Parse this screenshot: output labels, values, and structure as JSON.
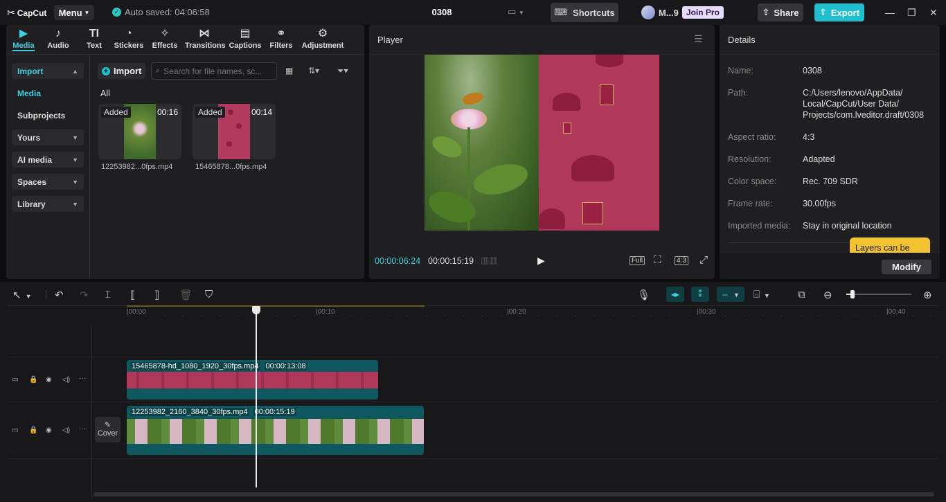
{
  "app": {
    "logo": "CapCut",
    "menu": "Menu",
    "autosave": "Auto saved: 04:06:58",
    "project": "0308",
    "shortcuts": "Shortcuts",
    "user": "M...9",
    "join_pro": "Join Pro",
    "share": "Share",
    "export": "Export"
  },
  "toolbar": [
    {
      "label": "Media",
      "icon": "media-icon",
      "active": true
    },
    {
      "label": "Audio",
      "icon": "audio-icon"
    },
    {
      "label": "Text",
      "icon": "text-icon"
    },
    {
      "label": "Stickers",
      "icon": "stickers-icon"
    },
    {
      "label": "Effects",
      "icon": "effects-icon"
    },
    {
      "label": "Transitions",
      "icon": "transitions-icon"
    },
    {
      "label": "Captions",
      "icon": "captions-icon"
    },
    {
      "label": "Filters",
      "icon": "filters-icon"
    },
    {
      "label": "Adjustment",
      "icon": "adjustment-icon"
    }
  ],
  "sidebar": {
    "import": "Import",
    "media": "Media",
    "subprojects": "Subprojects",
    "yours": "Yours",
    "ai_media": "AI media",
    "spaces": "Spaces",
    "library": "Library"
  },
  "media": {
    "import_btn": "Import",
    "search_placeholder": "Search for file names, sc...",
    "filter_all": "All",
    "items": [
      {
        "badge": "Added",
        "duration": "00:16",
        "name": "12253982...0fps.mp4"
      },
      {
        "badge": "Added",
        "duration": "00:14",
        "name": "15465878...0fps.mp4"
      }
    ]
  },
  "player": {
    "title": "Player",
    "current_time": "00:00:06:24",
    "total_time": "00:00:15:19",
    "full": "Full",
    "ratio": "4:3"
  },
  "details": {
    "title": "Details",
    "rows": [
      {
        "label": "Name:",
        "value": "0308"
      },
      {
        "label": "Path:",
        "value": "C:/Users/lenovo/AppData/ Local/CapCut/User Data/ Projects/com.lveditor.draft/0308"
      },
      {
        "label": "Aspect ratio:",
        "value": "4:3"
      },
      {
        "label": "Resolution:",
        "value": "Adapted"
      },
      {
        "label": "Color space:",
        "value": "Rec. 709 SDR"
      },
      {
        "label": "Frame rate:",
        "value": "30.00fps"
      },
      {
        "label": "Imported media:",
        "value": "Stay in original location"
      }
    ],
    "tooltip": "Layers can be",
    "modify": "Modify"
  },
  "timeline": {
    "ruler": [
      "00:00",
      "00:10",
      "00:20",
      "00:30",
      "00:40"
    ],
    "clip1": {
      "name": "15465878-hd_1080_1920_30fps.mp4",
      "duration": "00:00:13:08"
    },
    "clip2": {
      "name": "12253982_2160_3840_30fps.mp4",
      "duration": "00:00:15:19"
    },
    "cover": "Cover"
  },
  "colors": {
    "accent": "#1fbfd0",
    "clip_teal": "#0f5860",
    "pink": "#b83a5e"
  }
}
